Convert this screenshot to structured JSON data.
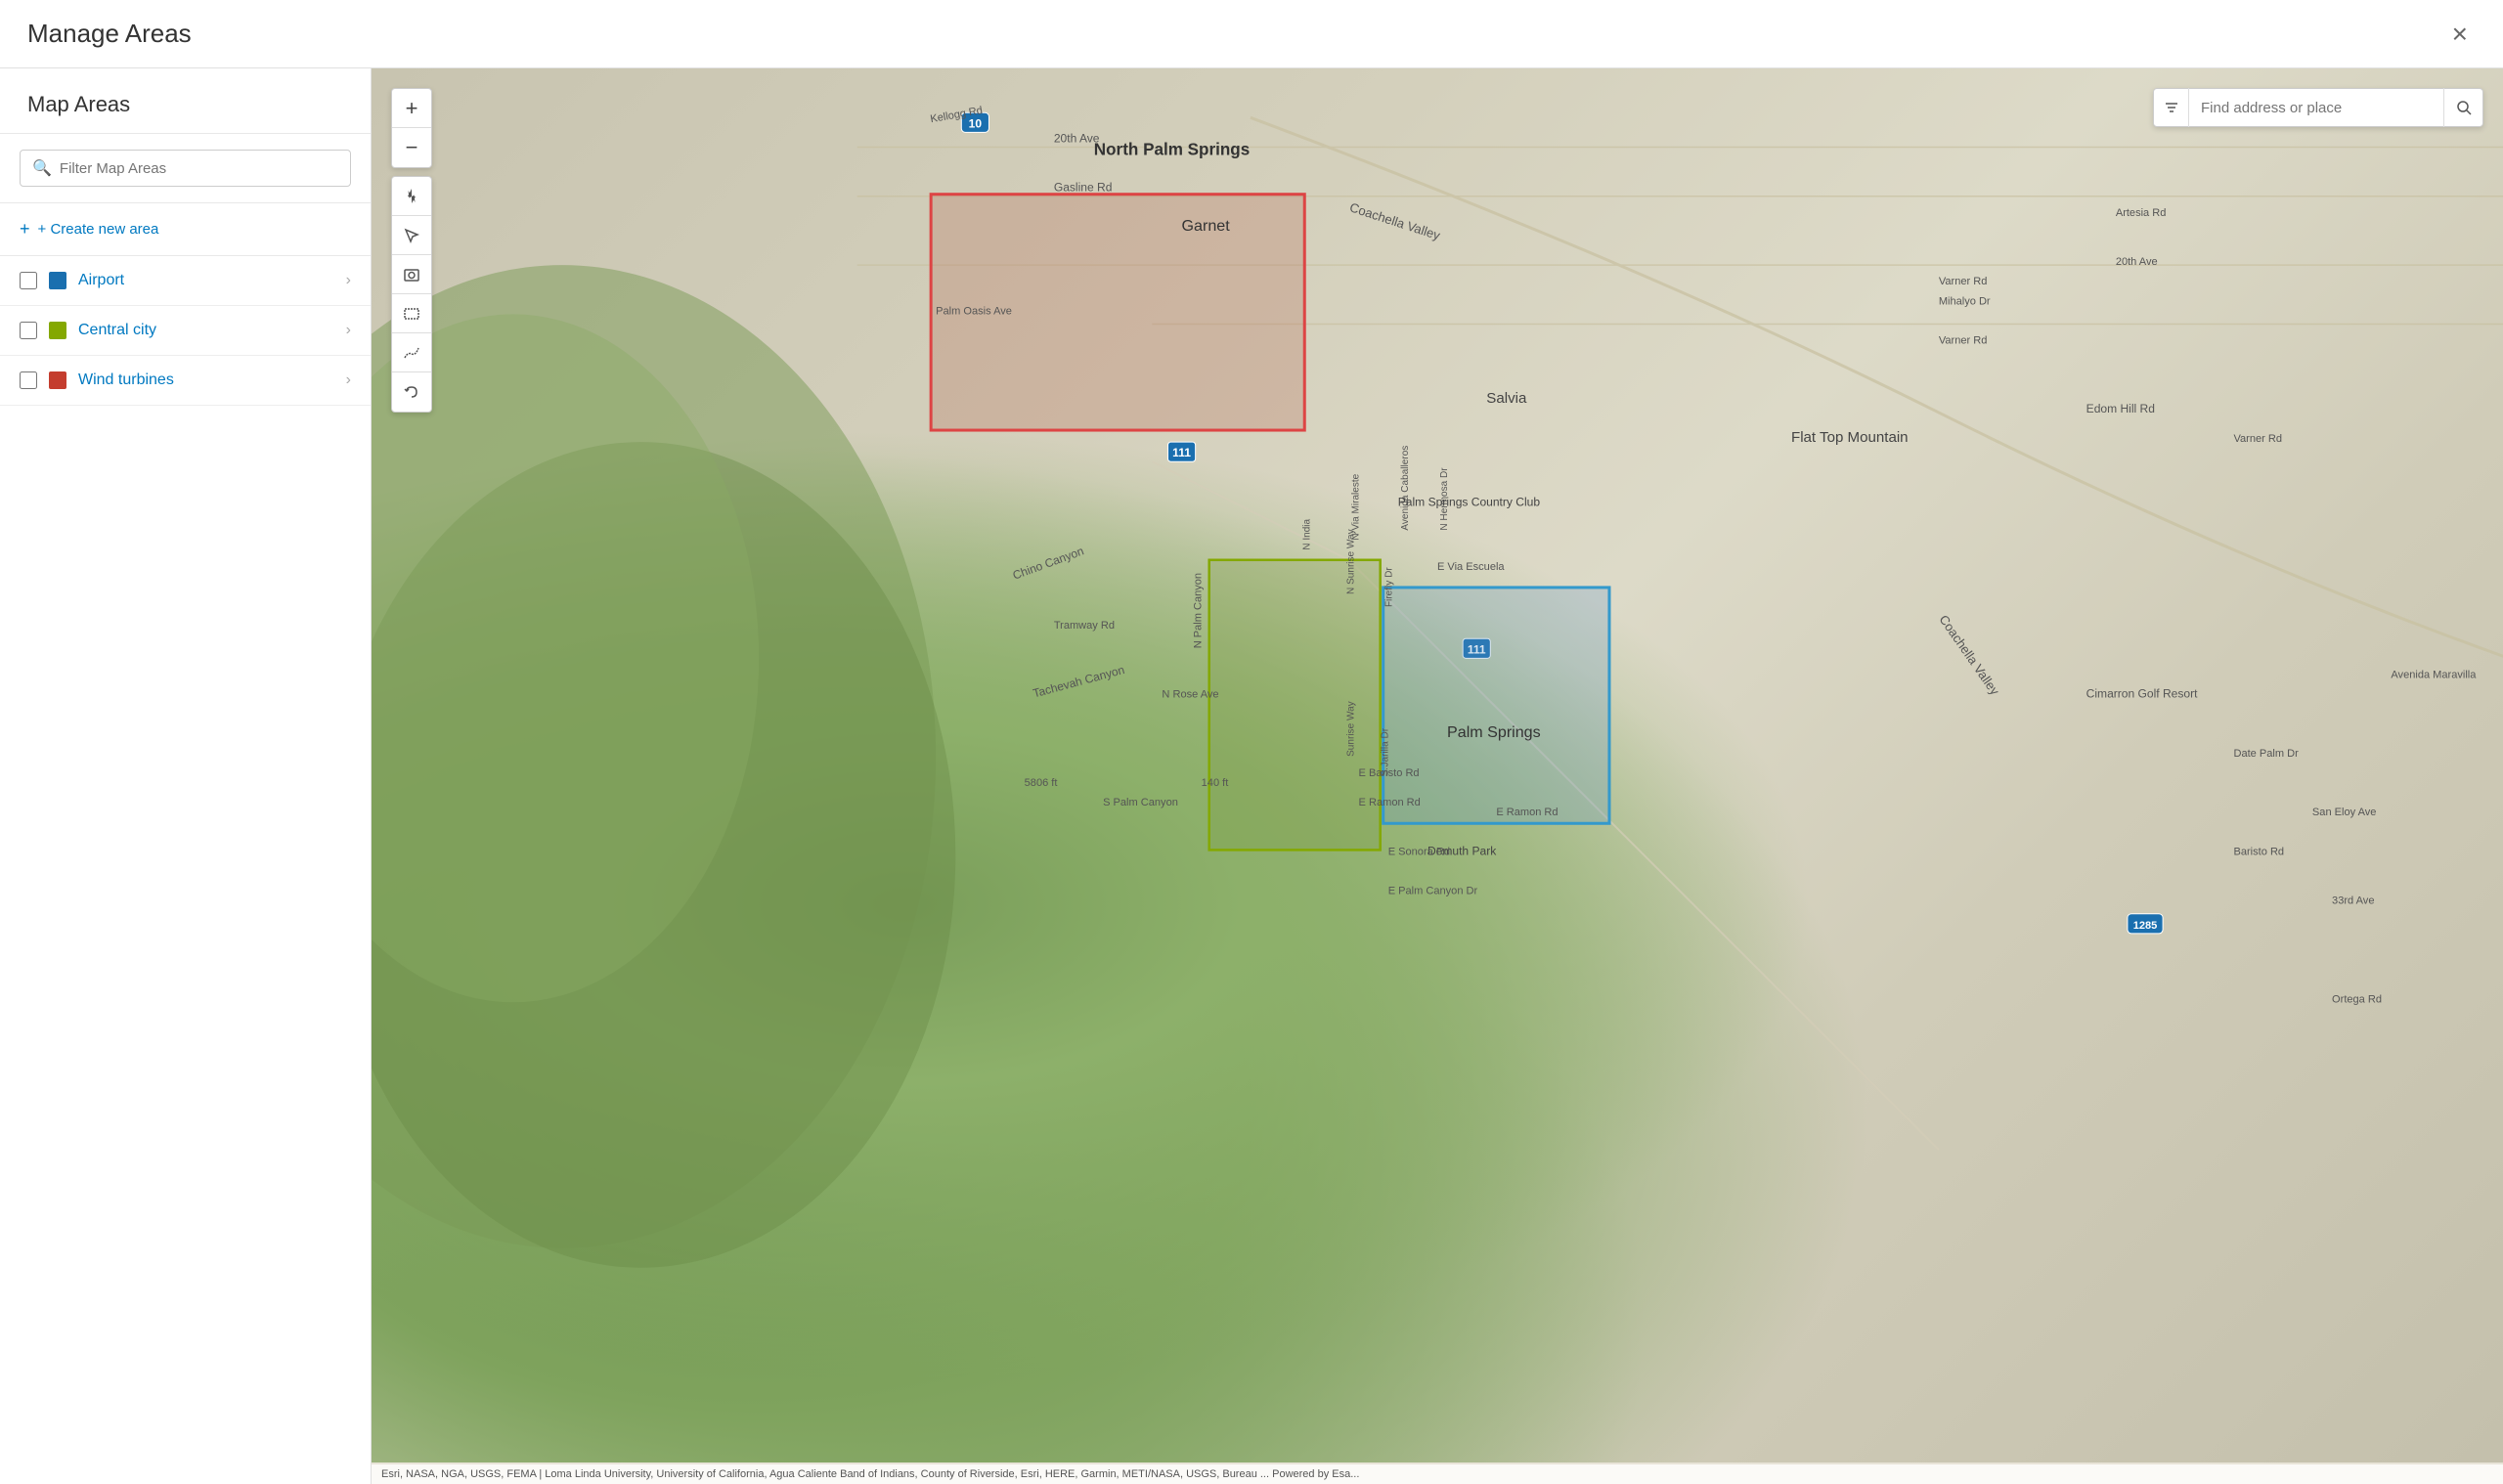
{
  "app": {
    "title": "Manage Areas",
    "close_label": "×"
  },
  "sidebar": {
    "title": "Map Areas",
    "filter_placeholder": "Filter Map Areas",
    "create_area_label": "+ Create new area",
    "areas": [
      {
        "name": "Airport",
        "color": "#1a6faf",
        "checked": false
      },
      {
        "name": "Central city",
        "color": "#84a800",
        "checked": false
      },
      {
        "name": "Wind turbines",
        "color": "#c43d2e",
        "checked": false
      }
    ]
  },
  "map": {
    "search_placeholder": "Find address or place",
    "attribution": "Esri, NASA, NGA, USGS, FEMA | Loma Linda University, University of California, Agua Caliente Band of Indians, County of Riverside, Esri, HERE, Garmin, METI/NASA, USGS, Bureau ...",
    "attribution_end": "Powered by Esa...",
    "labels": [
      "North Palm Springs",
      "Garnet",
      "Palm Springs",
      "Salvia",
      "Flat Top Mountain"
    ],
    "roads": [
      "20th Ave",
      "Gasline Rd",
      "Kellogg Rd",
      "Coachella Valley",
      "Tramway Rd",
      "N Rose Ave",
      "S Palm Canyon",
      "N India",
      "N Via Miraleste",
      "N Hermosa Dr",
      "N Sunrise Way",
      "E Baristo Rd",
      "E Ramon Rd",
      "E Sonora Rd",
      "E Palm Canyon Dr",
      "Chino Canyon",
      "Tachevah Canyon"
    ]
  },
  "toolbar": {
    "zoom_in": "+",
    "zoom_out": "−",
    "navigate_label": "Navigate",
    "select_label": "Select",
    "screenshot_label": "Screenshot",
    "draw_rect_label": "Draw Rectangle",
    "draw_freehand_label": "Draw Freehand",
    "undo_label": "Undo"
  }
}
